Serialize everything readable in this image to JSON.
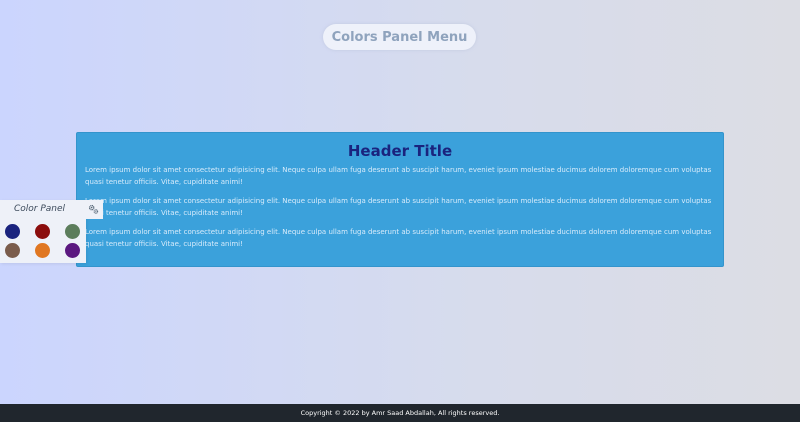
{
  "page": {
    "title": "Colors Panel Menu"
  },
  "content": {
    "header_title": "Header Title",
    "paragraphs": [
      "Lorem ipsum dolor sit amet consectetur adipisicing elit. Neque culpa ullam fuga deserunt ab suscipit harum, eveniet ipsum molestiae ducimus dolorem doloremque cum voluptas quasi tenetur officiis. Vitae, cupiditate animi!",
      "Lorem ipsum dolor sit amet consectetur adipisicing elit. Neque culpa ullam fuga deserunt ab suscipit harum, eveniet ipsum molestiae ducimus dolorem doloremque cum voluptas quasi tenetur officiis. Vitae, cupiditate animi!",
      "Lorem ipsum dolor sit amet consectetur adipisicing elit. Neque culpa ullam fuga deserunt ab suscipit harum, eveniet ipsum molestiae ducimus dolorem doloremque cum voluptas quasi tenetur officiis. Vitae, cupiditate animi!"
    ]
  },
  "color_panel": {
    "title": "Color Panel",
    "toggle_icon": "gear-icon",
    "swatches": [
      "#1a237e",
      "#8b0d0d",
      "#5c7d5c",
      "#7a5c4c",
      "#e07722",
      "#5b1880"
    ]
  },
  "colors": {
    "content_background": "#3ba1db",
    "header_title": "#1a237e",
    "footer_background": "#20262d"
  },
  "footer": {
    "text": "Copyright © 2022 by Amr Saad Abdallah, All rights reserved."
  }
}
